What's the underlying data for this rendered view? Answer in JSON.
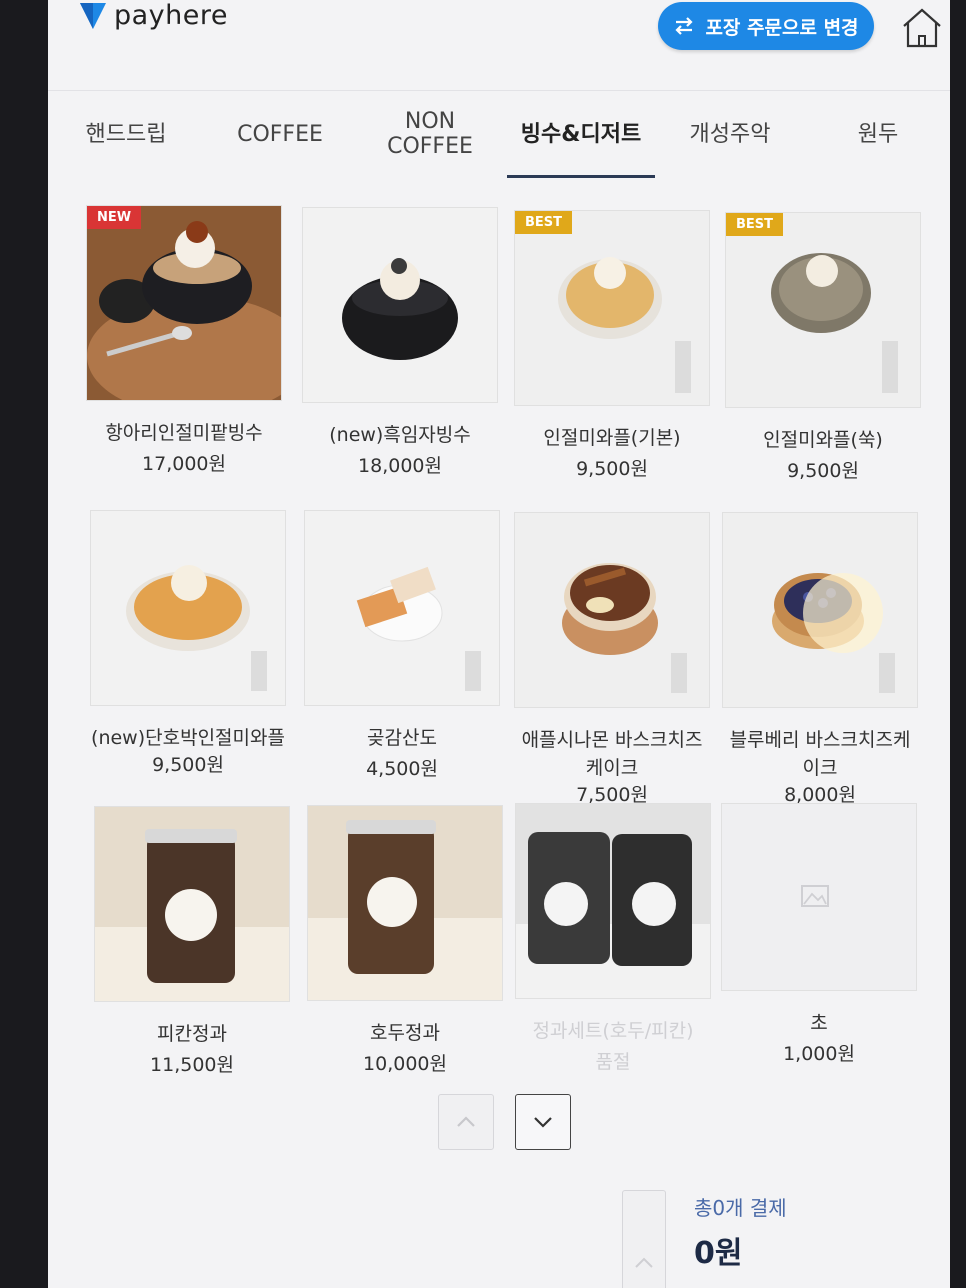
{
  "header": {
    "logo_text": "payhere",
    "order_toggle_label": "포장 주문으로 변경",
    "brand_color": "#1e88e5"
  },
  "tabs": [
    {
      "label": "핸드드립",
      "active": false
    },
    {
      "label": "COFFEE",
      "active": false
    },
    {
      "label": "NON\nCOFFEE",
      "active": false
    },
    {
      "label": "빙수&디저트",
      "active": true
    },
    {
      "label": "개성주악",
      "active": false
    },
    {
      "label": "원두",
      "active": false
    }
  ],
  "products": [
    {
      "name": "항아리인절미팥빙수",
      "price": "17,000원",
      "badge": "NEW",
      "image": "bingsu-pot"
    },
    {
      "name": "(new)흑임자빙수",
      "price": "18,000원",
      "badge": "",
      "image": "black-bingsu"
    },
    {
      "name": "인절미와플(기본)",
      "price": "9,500원",
      "badge": "BEST",
      "image": "waffle-plain"
    },
    {
      "name": "인절미와플(쑥)",
      "price": "9,500원",
      "badge": "BEST",
      "image": "waffle-mugwort"
    },
    {
      "name": "(new)단호박인절미와플",
      "price": "9,500원",
      "badge": "",
      "image": "waffle-pumpkin"
    },
    {
      "name": "곶감산도",
      "price": "4,500원",
      "badge": "",
      "image": "persimmon-sando"
    },
    {
      "name": "애플시나몬 바스크치즈케이크",
      "price": "7,500원",
      "badge": "",
      "image": "apple-cake"
    },
    {
      "name": "블루베리 바스크치즈케이크",
      "price": "8,000원",
      "badge": "",
      "image": "blueberry-cake"
    },
    {
      "name": "피칸정과",
      "price": "11,500원",
      "badge": "",
      "image": "pecan-jar"
    },
    {
      "name": "호두정과",
      "price": "10,000원",
      "badge": "",
      "image": "walnut-jar"
    },
    {
      "name": "정과세트(호두/피칸)",
      "price": "품절",
      "badge": "",
      "image": "jar-set",
      "sold_out": true
    },
    {
      "name": "초",
      "price": "1,000원",
      "badge": "",
      "image": "placeholder"
    }
  ],
  "pager": {
    "up_icon": "chevron-up-icon",
    "down_icon": "chevron-down-icon"
  },
  "footer": {
    "total_label": "총0개 결제",
    "total_amount": "0원"
  }
}
